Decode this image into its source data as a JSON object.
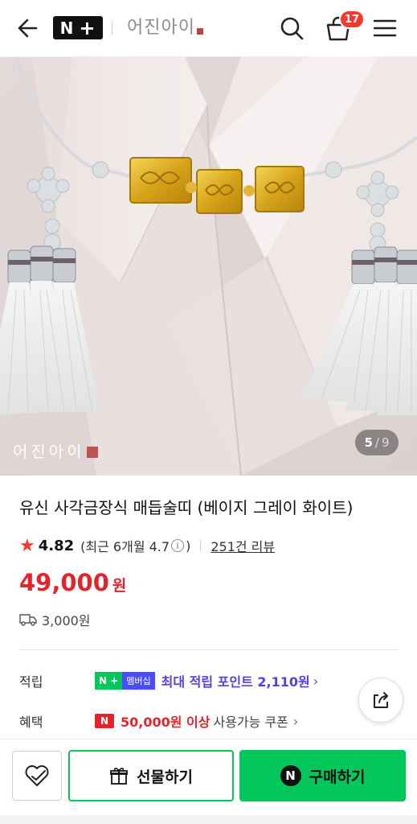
{
  "header": {
    "brand_badge": "N",
    "store_name": "어진아이",
    "cart_count": "17"
  },
  "gallery": {
    "watermark": "어진아이",
    "current": "5",
    "separator": "/",
    "total": "9"
  },
  "product": {
    "title": "유신 사각금장식 매듭술띠 (베이지 그레이 화이트)",
    "rating": "4.82",
    "recent_rating_prefix": "(최근 6개월 4.7",
    "recent_rating_suffix": ")",
    "review_count": "251건 리뷰",
    "price": "49,000",
    "currency": "원",
    "shipping": "3,000원"
  },
  "benefits": {
    "points_label": "적립",
    "membership_badge": "멤버십",
    "points_text": "최대 적립 포인트 2,110원",
    "coupon_label": "혜택",
    "coupon_badge": "N",
    "coupon_condition": "50,000원 이상",
    "coupon_text": "사용가능 쿠폰"
  },
  "actions": {
    "gift_label": "선물하기",
    "buy_label": "구매하기",
    "buy_icon": "N"
  },
  "colors": {
    "naver_green": "#03c75a",
    "price_red": "#e2242b",
    "point_purple": "#5b3ddf"
  }
}
